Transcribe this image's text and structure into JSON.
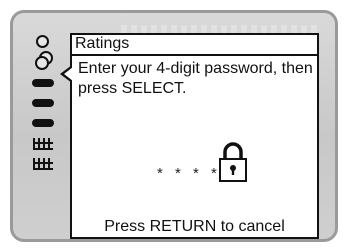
{
  "menu": {
    "icons": [
      {
        "name": "setup-circle-icon"
      },
      {
        "name": "dual-circle-icon"
      },
      {
        "name": "menu-bar-1-icon"
      },
      {
        "name": "menu-bar-2-icon"
      },
      {
        "name": "menu-bar-3-icon"
      },
      {
        "name": "parental-tree-1-icon"
      },
      {
        "name": "parental-tree-2-icon"
      }
    ]
  },
  "dialog": {
    "title": "Ratings",
    "message": "Enter your 4-digit password, then press SELECT.",
    "password_mask": "* * * *",
    "cancel_hint": "Press RETURN to cancel"
  }
}
